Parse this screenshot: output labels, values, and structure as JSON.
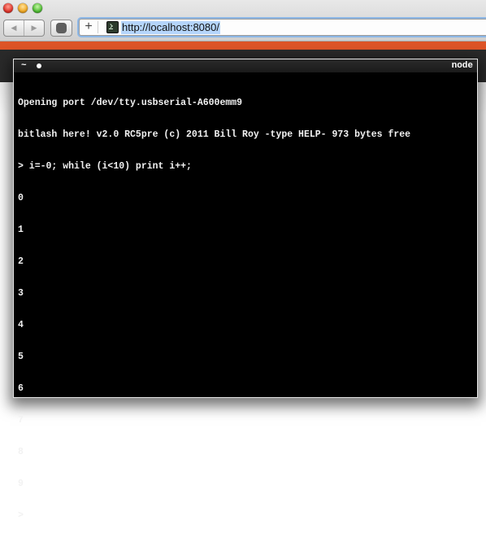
{
  "browser": {
    "url": "http://localhost:8080/",
    "new_tab_label": "+",
    "back_icon": "◀",
    "forward_icon": "▶",
    "stop_icon": "✋",
    "favicon": "terminal-icon"
  },
  "page": {
    "accent_color": "#dd5427"
  },
  "terminal": {
    "title_left": "~",
    "title_right": "node",
    "lines": [
      "Opening port /dev/tty.usbserial-A600emm9",
      "bitlash here! v2.0 RC5pre (c) 2011 Bill Roy -type HELP- 973 bytes free",
      "> i=-0; while (i<10) print i++;",
      "0",
      "1",
      "2",
      "3",
      "4",
      "5",
      "6",
      "7",
      "8",
      "9",
      ">"
    ]
  }
}
